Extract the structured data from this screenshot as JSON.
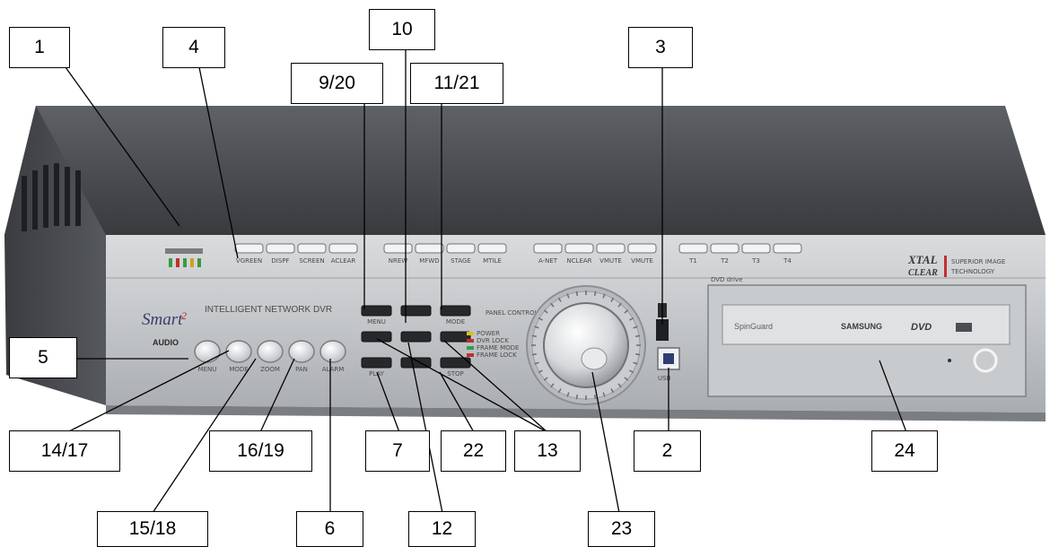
{
  "device": {
    "panel_title": "INTELLIGENT NETWORK DVR",
    "brand_logo": "Smart",
    "brand_logo_suffix": "2",
    "audio_label": "AUDIO",
    "xtal_line1": "XTAL",
    "xtal_line2": "CLEAR",
    "xtal_tagline1": "SUPERIOR IMAGE",
    "xtal_tagline2": "TECHNOLOGY",
    "dvd_drive_label": "DVD drive",
    "dvd_maker": "SAMSUNG",
    "dvd_logo": "DVD",
    "drive_model": "SpinGuard",
    "panel_control_label": "PANEL CONTROL",
    "usb_label": "USB",
    "func_button_labels": [
      "VGREEN",
      "DISPF",
      "SCREEN",
      "ACLEAR"
    ],
    "mode_button_labels": [
      "NREW",
      "MFWD",
      "STAGE",
      "MTILE"
    ],
    "misc_button_labels": [
      "A-NET",
      "NCLEAR",
      "VMUTE",
      "VMUTE"
    ],
    "tab_labels": [
      "T1",
      "T2",
      "T3",
      "T4"
    ],
    "round_button_labels": [
      "MENU",
      "MODE",
      "ZOOM",
      "PAN",
      "ALARM"
    ],
    "status_leds": [
      "POWER",
      "DVR LOCK",
      "FRAME MODE",
      "FRAME LOCK"
    ],
    "status_colors": [
      "#d4c028",
      "#c03030",
      "#2ca04c",
      "#c03030"
    ],
    "keypad_labels": [
      "MENU",
      "",
      "MODE",
      "",
      "",
      "",
      "PLAY",
      "",
      "STOP"
    ]
  },
  "callouts": [
    "1",
    "4",
    "10",
    "9/20",
    "11/21",
    "3",
    "5",
    "14/17",
    "16/19",
    "7",
    "22",
    "13",
    "2",
    "24",
    "15/18",
    "6",
    "12",
    "23"
  ]
}
